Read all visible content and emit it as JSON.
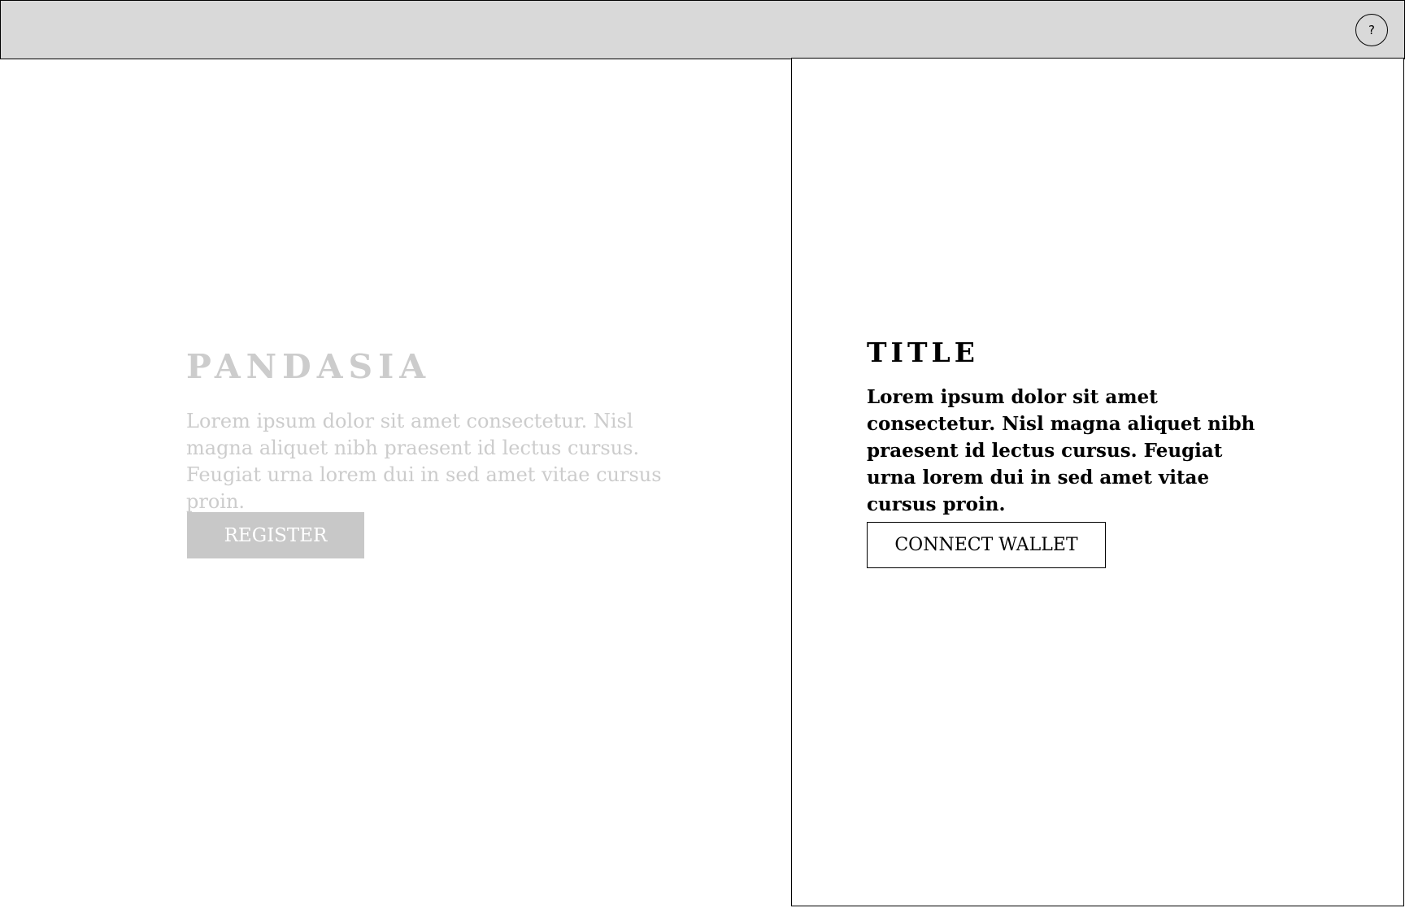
{
  "header": {
    "help_label": "?"
  },
  "left": {
    "brand": "PANDASIA",
    "description": "Lorem ipsum dolor sit amet consectetur. Nisl magna aliquet nibh praesent id lectus cursus. Feugiat urna lorem dui in sed amet vitae cursus proin.",
    "register_label": "REGISTER"
  },
  "right": {
    "title": "TITLE",
    "description": "Lorem ipsum dolor sit amet consectetur. Nisl magna aliquet nibh praesent id lectus cursus. Feugiat urna lorem dui in sed amet vitae cursus proin.",
    "connect_label": "CONNECT WALLET"
  },
  "colors": {
    "topbar": "#d9d9d9",
    "muted_text": "#cccccc",
    "register_bg": "#c8c8c8",
    "border": "#000000"
  }
}
